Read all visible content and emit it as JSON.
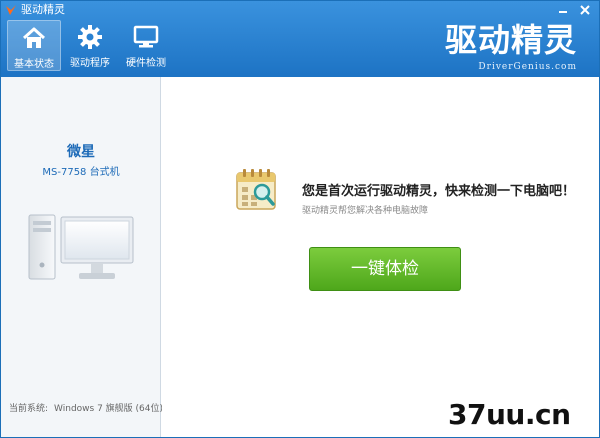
{
  "titlebar": {
    "title": "驱动精灵",
    "minimize_icon": "minimize-icon",
    "close_icon": "close-icon"
  },
  "nav": {
    "items": [
      {
        "label": "基本状态",
        "icon": "home-icon",
        "active": true
      },
      {
        "label": "驱动程序",
        "icon": "gear-icon",
        "active": false
      },
      {
        "label": "硬件检测",
        "icon": "monitor-icon",
        "active": false
      }
    ]
  },
  "brand": {
    "logo_text": "驱动精灵",
    "site": "DriverGenius.com"
  },
  "device": {
    "name": "微星",
    "model": "MS-7758 台式机"
  },
  "system": {
    "label": "当前系统:",
    "value": "Windows 7 旗舰版 (64位)"
  },
  "main": {
    "headline": "您是首次运行驱动精灵，快来检测一下电脑吧！",
    "subline": "驱动精灵帮您解决各种电脑故障",
    "scan_button": "一键体检"
  },
  "watermark": "37uu.cn",
  "colors": {
    "header_blue": "#1d73c4",
    "accent_green": "#4ea71b",
    "device_blue": "#1e6bb8"
  }
}
